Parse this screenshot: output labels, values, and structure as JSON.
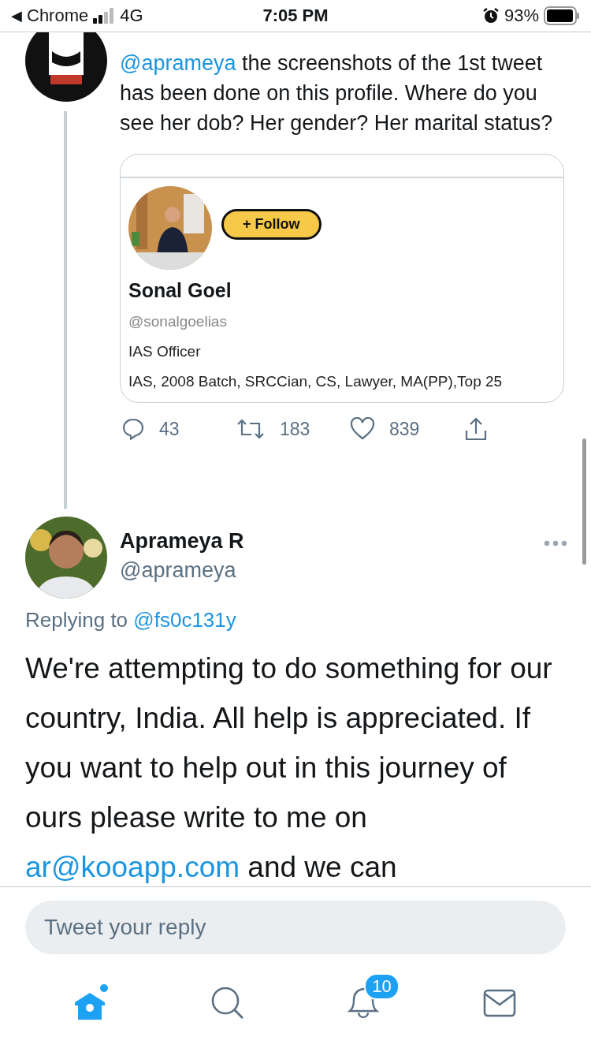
{
  "status_bar": {
    "back_arrow": "◀",
    "back_label": "Chrome",
    "network": "4G",
    "time": "7:05 PM",
    "battery": "93%"
  },
  "parent_tweet": {
    "text": [
      {
        "kind": "link",
        "text": "@aprameya"
      },
      {
        "kind": "plain",
        "text": " the screenshots of the 1st tweet has been done on this profile. Where do you see her dob? Her gender? Her marital status?"
      }
    ],
    "card": {
      "follow_label": "+ Follow",
      "name": "Sonal Goel",
      "handle": "@sonalgoelias",
      "title": "IAS Officer",
      "bio": "IAS, 2008 Batch, SRCCian, CS, Lawyer, MA(PP),Top 25"
    },
    "actions": {
      "replies": "43",
      "retweets": "183",
      "likes": "839"
    }
  },
  "main_tweet": {
    "name": "Aprameya R",
    "handle": "@aprameya",
    "replying_label": "Replying to",
    "replying_handle": "@fs0c131y",
    "text": [
      {
        "kind": "plain",
        "text": "We're attempting to do something for our country, India. All help is appreciated. If you want to help out in this journey of ours please write to me on "
      },
      {
        "kind": "link",
        "text": "ar@kooapp.com"
      },
      {
        "kind": "plain",
        "text": " and we can"
      }
    ]
  },
  "reply_box": {
    "placeholder": "Tweet your reply"
  },
  "tab_bar": {
    "notifications_badge": "10",
    "tabs": [
      {
        "kind": "home",
        "selected": true
      },
      {
        "kind": "search",
        "selected": false
      },
      {
        "kind": "notifications",
        "selected": false
      },
      {
        "kind": "messages",
        "selected": false
      }
    ]
  }
}
